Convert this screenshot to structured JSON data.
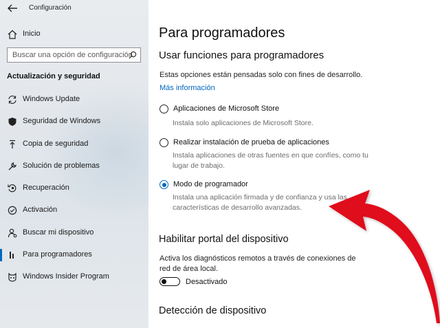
{
  "window": {
    "title": "Configuración"
  },
  "sidebar": {
    "home_label": "Inicio",
    "search_placeholder": "Buscar una opción de configuración",
    "section_heading": "Actualización y seguridad",
    "items": [
      {
        "label": "Windows Update",
        "icon": "sync-icon"
      },
      {
        "label": "Seguridad de Windows",
        "icon": "shield-icon"
      },
      {
        "label": "Copia de seguridad",
        "icon": "backup-arrow-icon"
      },
      {
        "label": "Solución de problemas",
        "icon": "wrench-icon"
      },
      {
        "label": "Recuperación",
        "icon": "recovery-icon"
      },
      {
        "label": "Activación",
        "icon": "check-circle-icon"
      },
      {
        "label": "Buscar mi dispositivo",
        "icon": "person-locate-icon"
      },
      {
        "label": "Para programadores",
        "icon": "developer-bars-icon",
        "selected": true
      },
      {
        "label": "Windows Insider Program",
        "icon": "insider-cat-icon"
      }
    ]
  },
  "main": {
    "title": "Para programadores",
    "subtitle": "Usar funciones para programadores",
    "description": "Estas opciones están pensadas solo con fines de desarrollo.",
    "more_info_link": "Más información",
    "options": [
      {
        "label": "Aplicaciones de Microsoft Store",
        "help": "Instala solo aplicaciones de Microsoft Store.",
        "checked": false
      },
      {
        "label": "Realizar instalación de prueba de aplicaciones",
        "help": "Instala aplicaciones de otras fuentes en que confíes, como tu lugar de trabajo.",
        "checked": false
      },
      {
        "label": "Modo de programador",
        "help": "Instala una aplicación firmada y de confianza y usa las características de desarrollo avanzadas.",
        "checked": true
      }
    ],
    "portal": {
      "heading": "Habilitar portal del dispositivo",
      "description": "Activa los diagnósticos remotos a través de conexiones de red de área local.",
      "toggle_state": "Desactivado"
    },
    "discovery": {
      "heading": "Detección de dispositivo"
    }
  },
  "colors": {
    "accent": "#0067c0",
    "annotation_arrow": "#e0101a"
  }
}
